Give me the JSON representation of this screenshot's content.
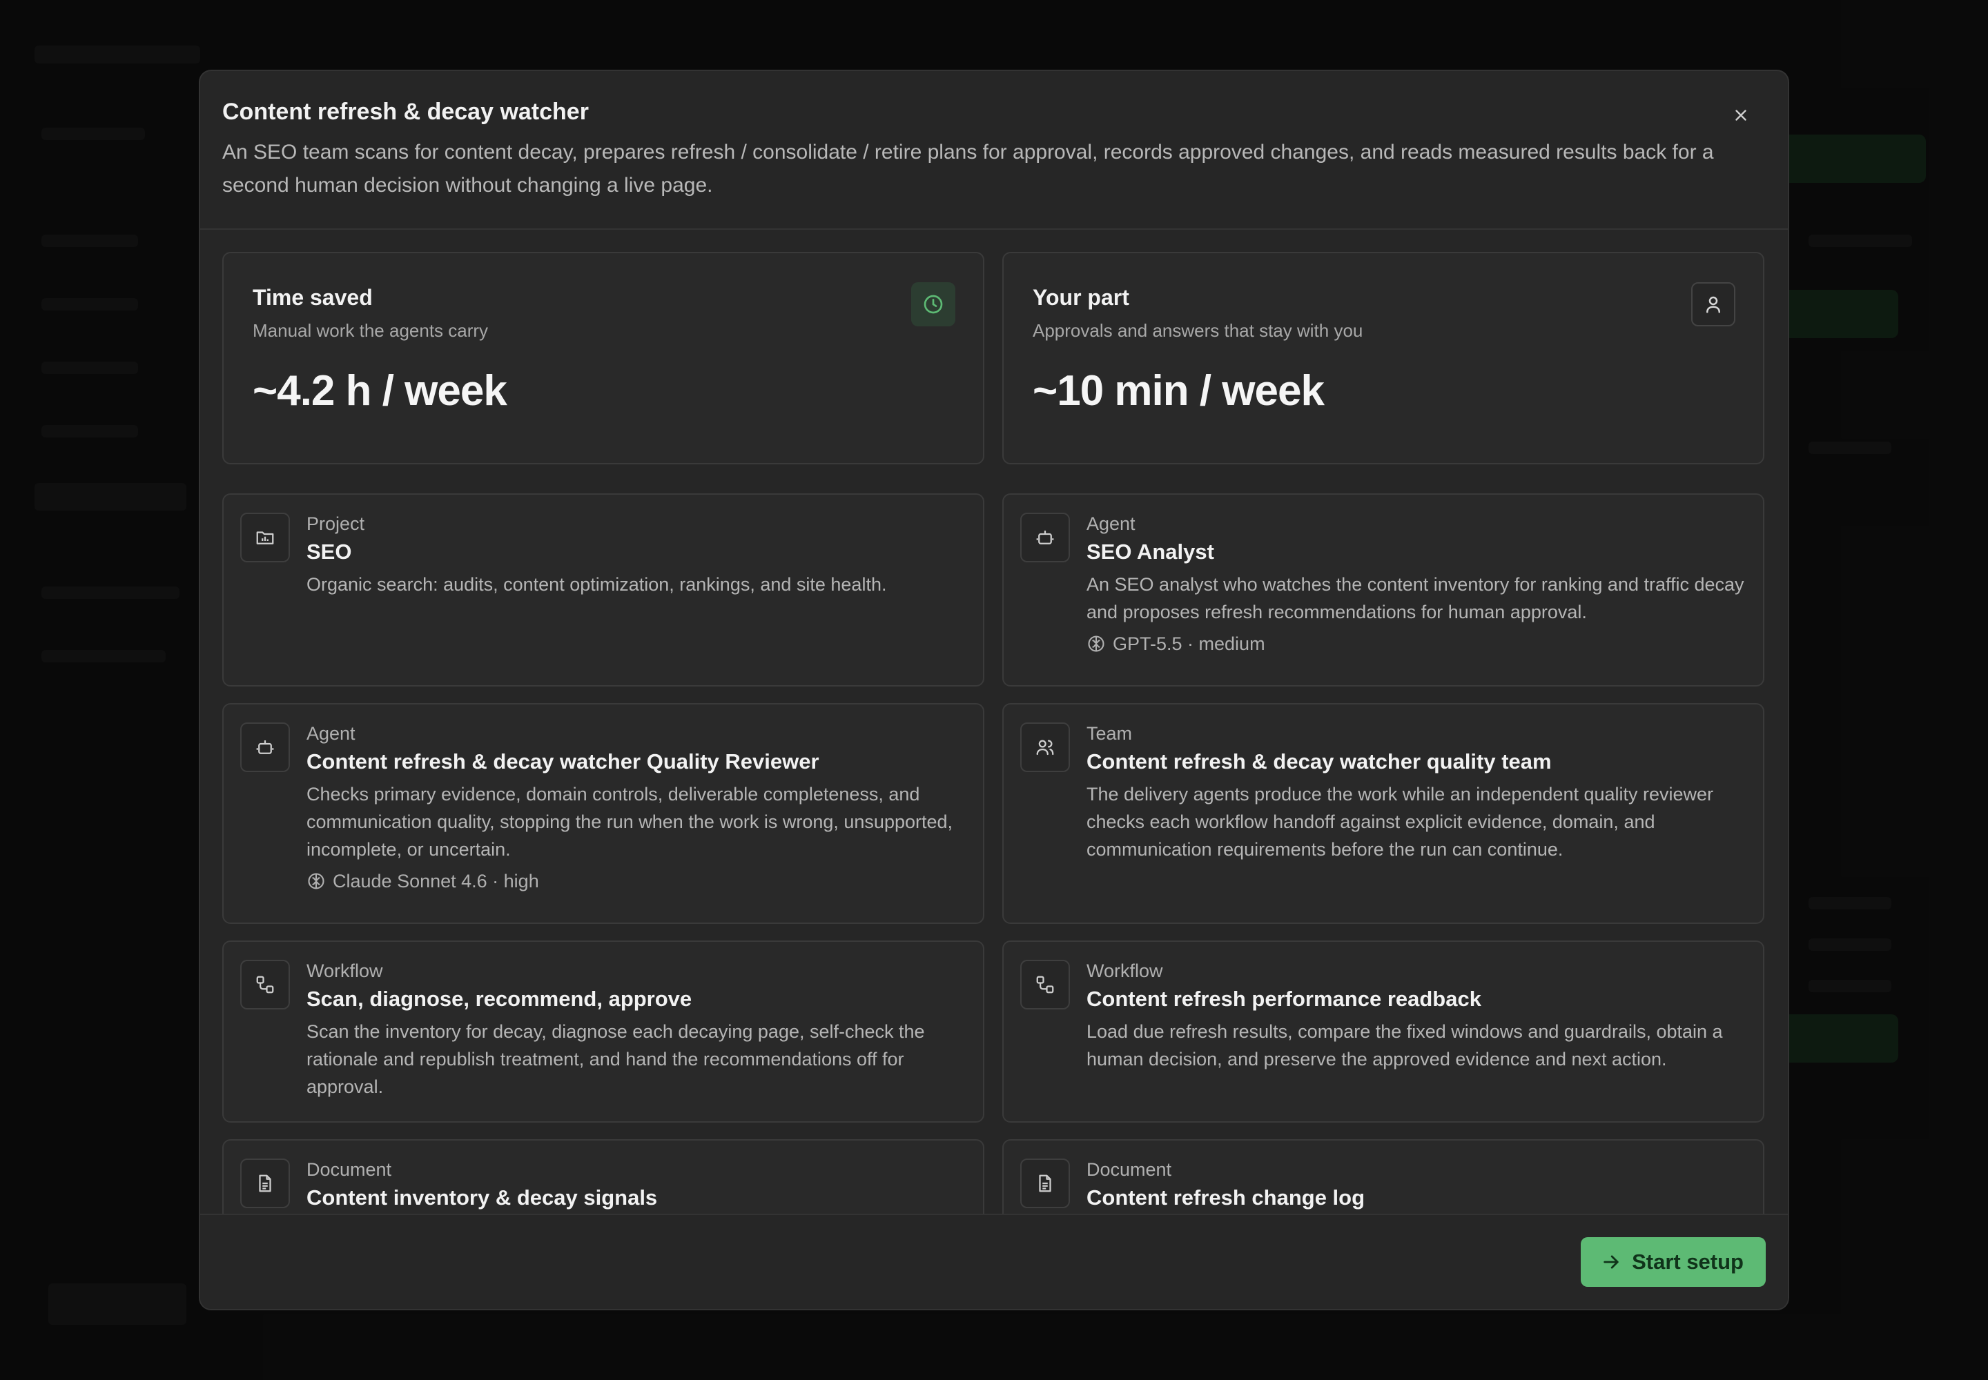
{
  "modal": {
    "title": "Content refresh & decay watcher",
    "description": "An SEO team scans for content decay, prepares refresh / consolidate / retire plans for approval, records approved changes, and reads measured results back for a second human decision without changing a live page."
  },
  "stats": [
    {
      "title": "Time saved",
      "subtitle": "Manual work the agents carry",
      "value": "~4.2 h / week",
      "icon": "clock-icon"
    },
    {
      "title": "Your part",
      "subtitle": "Approvals and answers that stay with you",
      "value": "~10 min / week",
      "icon": "user-icon"
    }
  ],
  "items": [
    {
      "kind": "Project",
      "name": "SEO",
      "description": "Organic search: audits, content optimization, rankings, and site health.",
      "model": "",
      "icon": "folder-icon"
    },
    {
      "kind": "Agent",
      "name": "SEO Analyst",
      "description": "An SEO analyst who watches the content inventory for ranking and traffic decay and proposes refresh recommendations for human approval.",
      "model": "GPT-5.5 · medium",
      "icon": "bot-icon"
    },
    {
      "kind": "Agent",
      "name": "Content refresh & decay watcher Quality Reviewer",
      "description": "Checks primary evidence, domain controls, deliverable completeness, and communication quality, stopping the run when the work is wrong, unsupported, incomplete, or uncertain.",
      "model": "Claude Sonnet 4.6 · high",
      "icon": "bot-icon"
    },
    {
      "kind": "Team",
      "name": "Content refresh & decay watcher quality team",
      "description": "The delivery agents produce the work while an independent quality reviewer checks each workflow handoff against explicit evidence, domain, and communication requirements before the run can continue.",
      "model": "",
      "icon": "users-icon"
    },
    {
      "kind": "Workflow",
      "name": "Scan, diagnose, recommend, approve",
      "description": "Scan the inventory for decay, diagnose each decaying page, self-check the rationale and republish treatment, and hand the recommendations off for approval.",
      "model": "",
      "icon": "workflow-icon"
    },
    {
      "kind": "Workflow",
      "name": "Content refresh performance readback",
      "description": "Load due refresh results, compare the fixed windows and guardrails, obtain a human decision, and preserve the approved evidence and next action.",
      "model": "",
      "icon": "workflow-icon"
    },
    {
      "kind": "Document",
      "name": "Content inventory & decay signals",
      "description": "",
      "model": "",
      "icon": "document-icon"
    },
    {
      "kind": "Document",
      "name": "Content refresh change log",
      "description": "",
      "model": "",
      "icon": "document-icon"
    }
  ],
  "footer": {
    "start_label": "Start setup"
  },
  "colors": {
    "accent": "#5dba74",
    "modal_bg": "#262626",
    "card_bg": "#292929"
  }
}
